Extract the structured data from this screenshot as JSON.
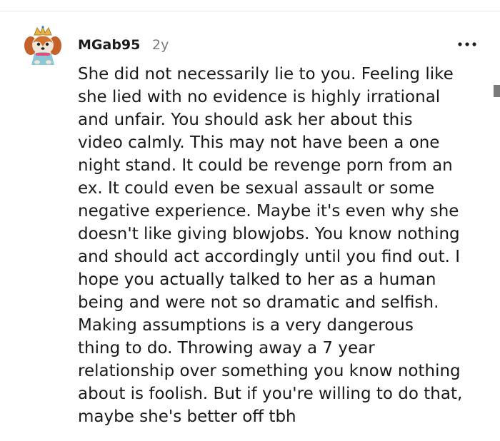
{
  "comment": {
    "username": "MGab95",
    "age": "2y",
    "more_icon": "more-horizontal-icon",
    "body_lines": [
      "She did not necessarily lie to you. Feeling like",
      "she lied with no evidence is highly irrational",
      "and unfair. You should ask her about this",
      "video calmly. This may not have been a one",
      "night stand. It could be revenge porn from an",
      "ex. It could even be sexual assault or some",
      "negative experience. Maybe it's even why she",
      "doesn't like giving blowjobs. You know nothing",
      "and should act accordingly until you find out. I",
      "hope you actually talked to her as a human",
      "being and were not so dramatic and selfish.",
      "Making assumptions is a very dangerous",
      "thing to do. Throwing away a 7 year",
      "relationship over something you know nothing",
      "about is foolish. But if you're willing to do that,",
      "maybe she's better off tbh"
    ]
  },
  "colors": {
    "text": "#1a1a1b",
    "muted": "#7c7c7c",
    "divider": "#e6e6e6"
  }
}
